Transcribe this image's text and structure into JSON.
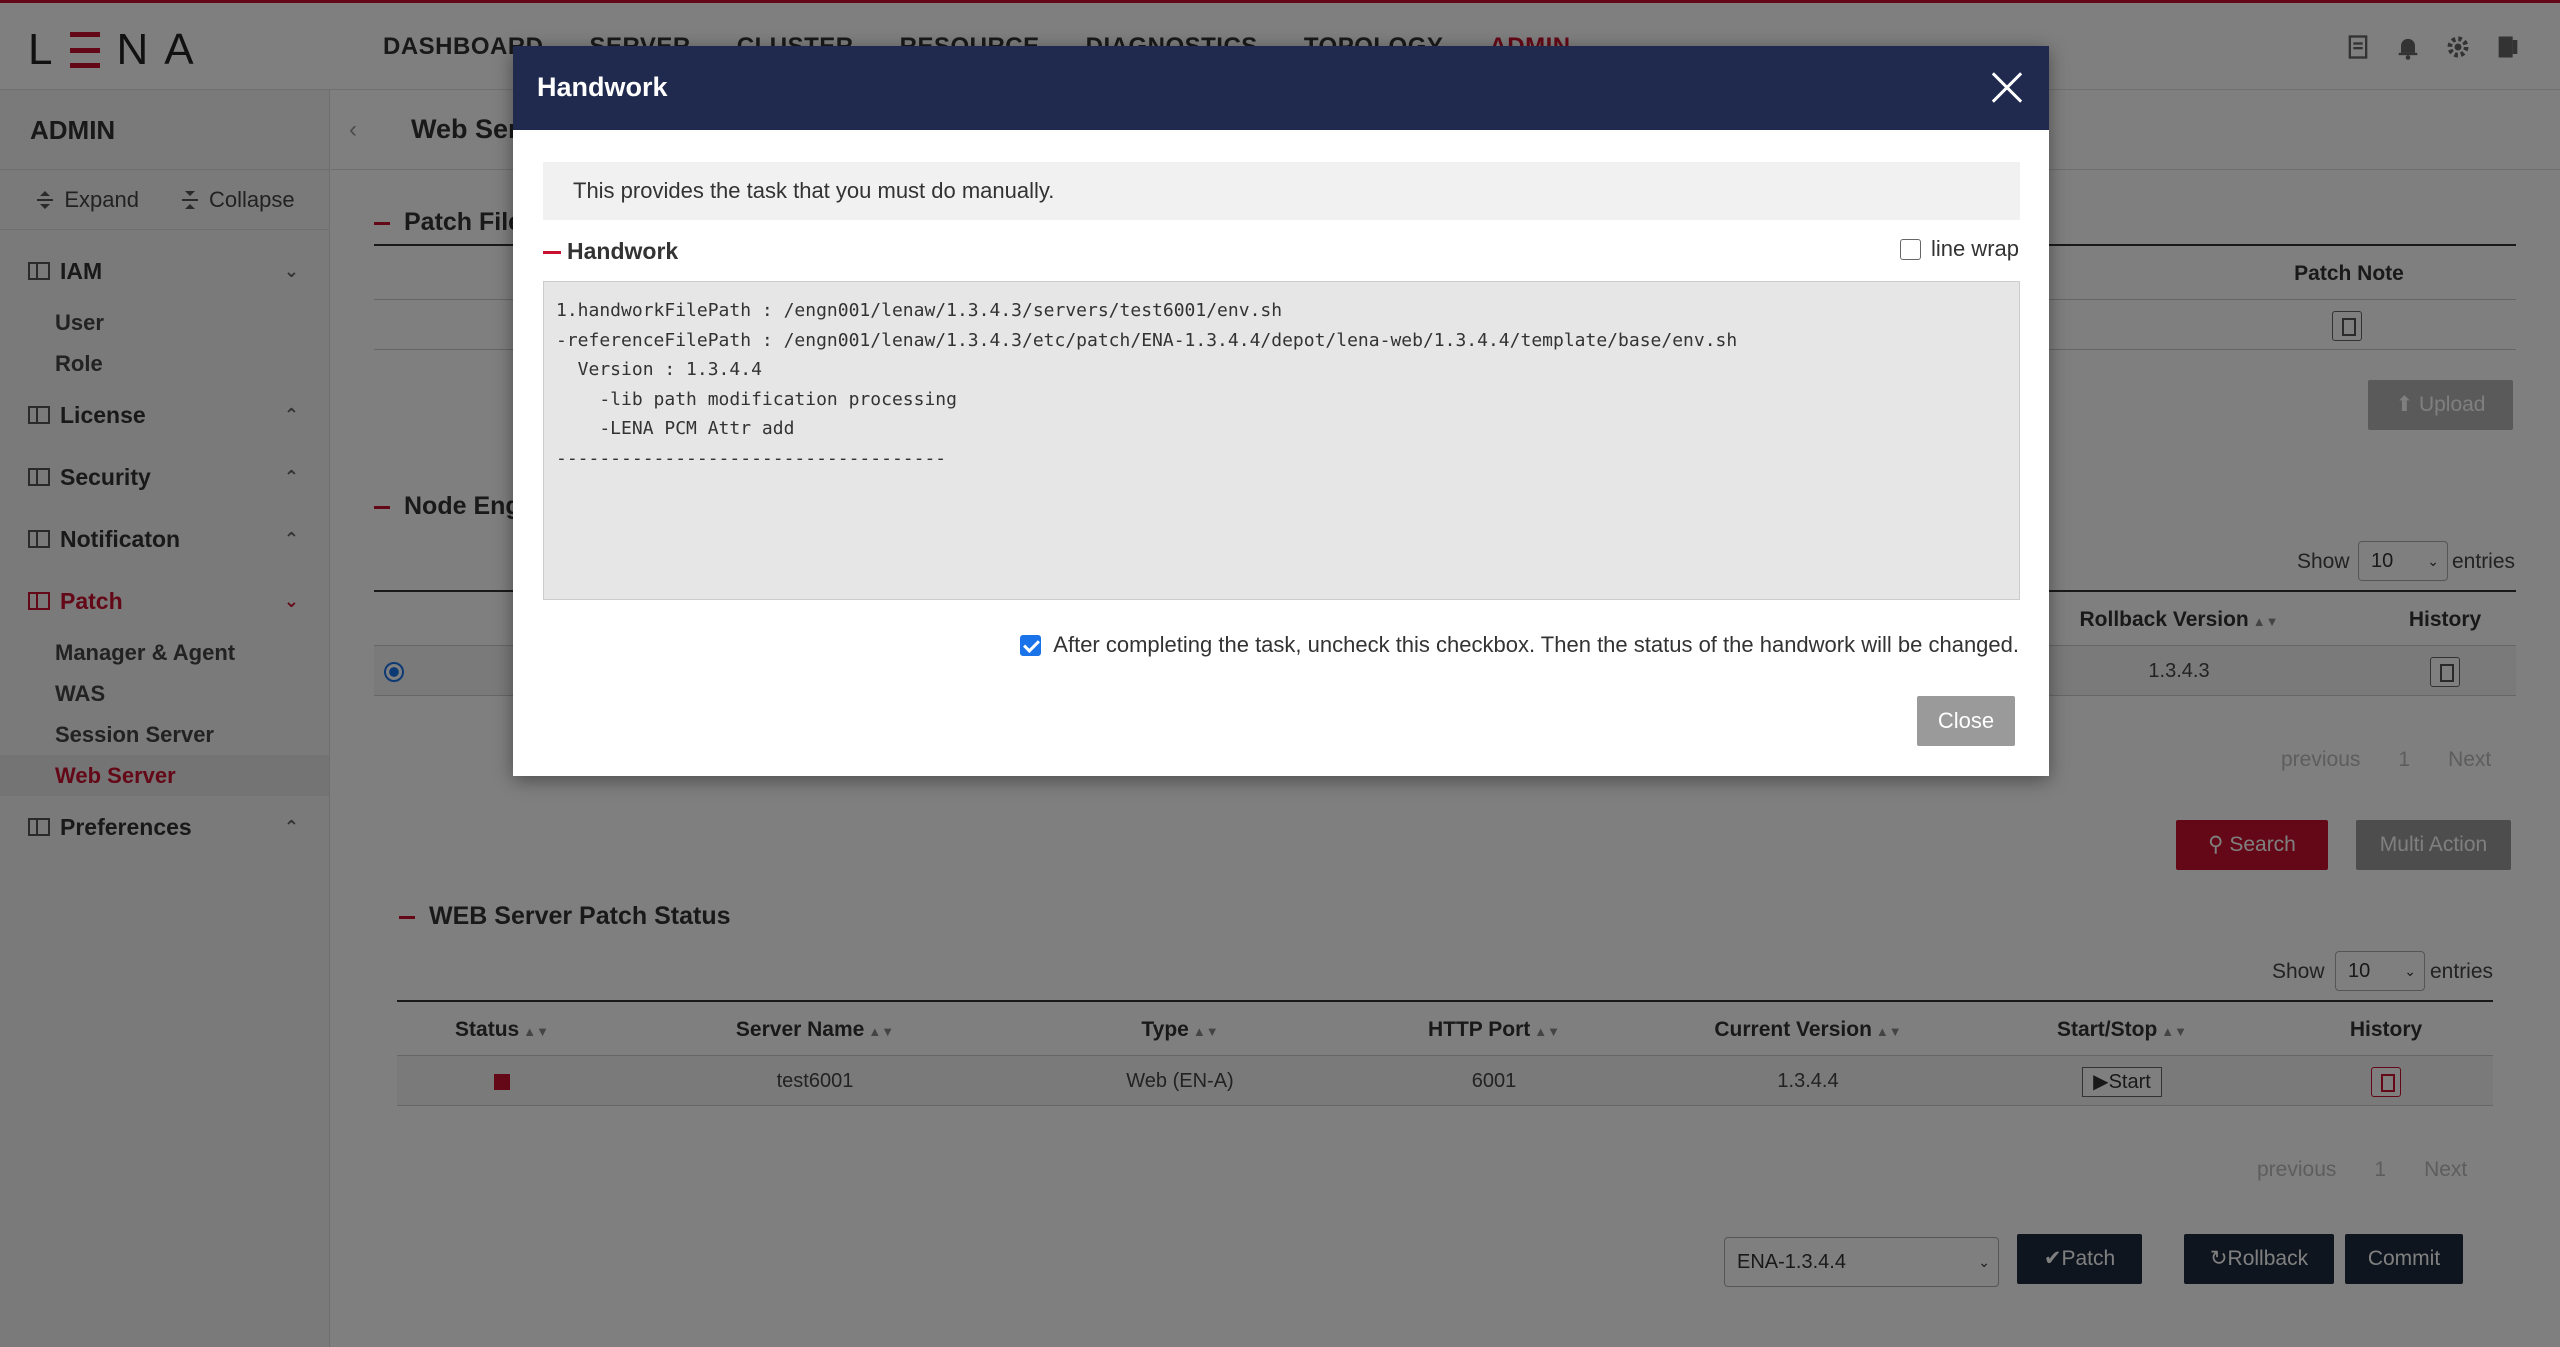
{
  "app": {
    "logo": "LENA"
  },
  "nav": [
    "DASHBOARD",
    "SERVER",
    "CLUSTER",
    "RESOURCE",
    "DIAGNOSTICS",
    "TOPOLOGY",
    "ADMIN"
  ],
  "sidebar": {
    "title": "ADMIN",
    "expand_label": "Expand",
    "collapse_label": "Collapse",
    "groups": [
      {
        "label": "IAM",
        "items": [
          "User",
          "Role"
        ]
      },
      {
        "label": "License"
      },
      {
        "label": "Security"
      },
      {
        "label": "Notificaton"
      },
      {
        "label": "Patch",
        "items": [
          "Manager & Agent",
          "WAS",
          "Session Server",
          "Web Server"
        ]
      },
      {
        "label": "Preferences"
      }
    ]
  },
  "page": {
    "title": "Web Ser",
    "patch_file_section": "Patch File",
    "patch_note_header": "Patch Note",
    "upload_label": "Upload",
    "node_section": "Node Engi",
    "show_label": "Show",
    "entries_label": "entries",
    "page_size": "10",
    "rollback_version_header": "Rollback Version",
    "history_header": "History",
    "rollback_version_value": "1.3.4.3",
    "pager": {
      "previous": "previous",
      "page": "1",
      "next": "Next"
    },
    "search_label": "Search",
    "multi_action_label": "Multi Action"
  },
  "status_section": {
    "title": "WEB Server Patch Status",
    "show_label": "Show",
    "entries_label": "entries",
    "page_size": "10",
    "columns": [
      "Status",
      "Server Name",
      "Type",
      "HTTP Port",
      "Current Version",
      "Start/Stop",
      "History"
    ],
    "row": {
      "server_name": "test6001",
      "type": "Web (EN-A)",
      "http_port": "6001",
      "current_version": "1.3.4.4",
      "start_label": "Start"
    },
    "pager": {
      "previous": "previous",
      "page": "1",
      "next": "Next"
    },
    "version_select": "ENA-1.3.4.4",
    "patch_label": "Patch",
    "rollback_label": "Rollback",
    "commit_label": "Commit"
  },
  "modal": {
    "title": "Handwork",
    "notice": "This provides the task that you must do manually.",
    "section_title": "Handwork",
    "line_wrap_label": "line wrap",
    "line_wrap_checked": false,
    "code_lines": [
      "1.handworkFilePath : /engn001/lenaw/1.3.4.3/servers/test6001/env.sh",
      "-referenceFilePath : /engn001/lenaw/1.3.4.3/etc/patch/ENA-1.3.4.4/depot/lena-web/1.3.4.4/template/base/env.sh",
      "  Version : 1.3.4.4",
      "    -lib path modification processing",
      "    -LENA PCM Attr add",
      "------------------------------------"
    ],
    "confirm_label": "After completing the task, uncheck this checkbox. Then the status of the handwork will be changed.",
    "confirm_checked": true,
    "close_label": "Close"
  },
  "colors": {
    "accent": "#c8102e",
    "modal_header": "#1f2a4e",
    "dark_button": "#1f2a3e",
    "checkbox": "#1a73e8"
  }
}
